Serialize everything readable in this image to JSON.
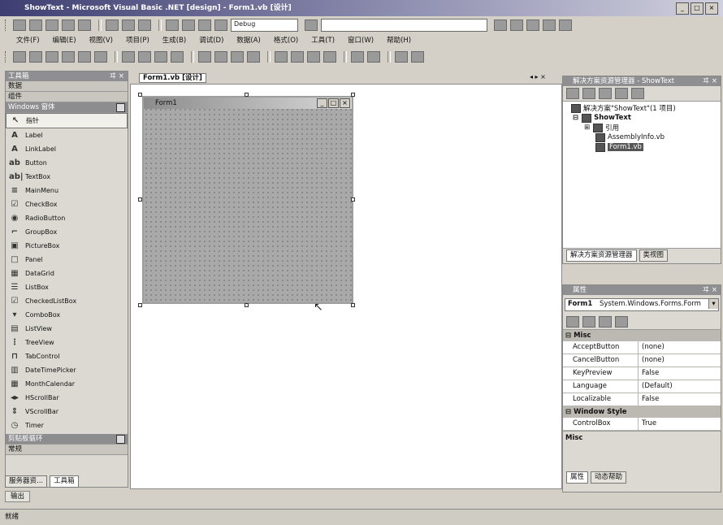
{
  "window": {
    "title": "ShowText - Microsoft Visual Basic .NET [design] - Form1.vb [设计]",
    "buttons": [
      "_",
      "□",
      "×"
    ]
  },
  "toolbar": {
    "config_combo": "Debug",
    "find_combo": ""
  },
  "menubar": {
    "items": [
      "文件(F)",
      "编辑(E)",
      "视图(V)",
      "项目(P)",
      "生成(B)",
      "调试(D)",
      "数据(A)",
      "格式(O)",
      "工具(T)",
      "窗口(W)",
      "帮助(H)"
    ]
  },
  "toolbox": {
    "title": "工具箱",
    "pin": "ヰ ×",
    "categories_top": [
      "数据",
      "组件"
    ],
    "active_category": "Windows 窗体",
    "tools": [
      {
        "label": "指针",
        "icon": "pointer-icon",
        "glyph": "↖"
      },
      {
        "label": "Label",
        "icon": "label-icon",
        "glyph": "A"
      },
      {
        "label": "LinkLabel",
        "icon": "linklabel-icon",
        "glyph": "A"
      },
      {
        "label": "Button",
        "icon": "button-icon",
        "glyph": "ab"
      },
      {
        "label": "TextBox",
        "icon": "textbox-icon",
        "glyph": "ab|"
      },
      {
        "label": "MainMenu",
        "icon": "mainmenu-icon",
        "glyph": "≡"
      },
      {
        "label": "CheckBox",
        "icon": "checkbox-icon",
        "glyph": "☑"
      },
      {
        "label": "RadioButton",
        "icon": "radiobutton-icon",
        "glyph": "◉"
      },
      {
        "label": "GroupBox",
        "icon": "groupbox-icon",
        "glyph": "⌐"
      },
      {
        "label": "PictureBox",
        "icon": "picturebox-icon",
        "glyph": "▣"
      },
      {
        "label": "Panel",
        "icon": "panel-icon",
        "glyph": "□"
      },
      {
        "label": "DataGrid",
        "icon": "datagrid-icon",
        "glyph": "▦"
      },
      {
        "label": "ListBox",
        "icon": "listbox-icon",
        "glyph": "☰"
      },
      {
        "label": "CheckedListBox",
        "icon": "checkedlistbox-icon",
        "glyph": "☑"
      },
      {
        "label": "ComboBox",
        "icon": "combobox-icon",
        "glyph": "▾"
      },
      {
        "label": "ListView",
        "icon": "listview-icon",
        "glyph": "▤"
      },
      {
        "label": "TreeView",
        "icon": "treeview-icon",
        "glyph": "⋮"
      },
      {
        "label": "TabControl",
        "icon": "tabcontrol-icon",
        "glyph": "⊓"
      },
      {
        "label": "DateTimePicker",
        "icon": "datetimepicker-icon",
        "glyph": "▥"
      },
      {
        "label": "MonthCalendar",
        "icon": "monthcalendar-icon",
        "glyph": "▦"
      },
      {
        "label": "HScrollBar",
        "icon": "hscrollbar-icon",
        "glyph": "◂▸"
      },
      {
        "label": "VScrollBar",
        "icon": "vscrollbar-icon",
        "glyph": "⇕"
      },
      {
        "label": "Timer",
        "icon": "timer-icon",
        "glyph": "◷"
      }
    ],
    "categories_bottom": [
      "剪贴板循环",
      "常规"
    ],
    "bottom_tabs": [
      "服务器资...",
      "工具箱"
    ]
  },
  "document": {
    "tab_label": "Form1.vb [设计]",
    "nav": "◂ ▸ ×",
    "form_title": "Form1",
    "form_buttons": [
      "_",
      "□",
      "×"
    ]
  },
  "solution": {
    "title": "解决方案资源管理器 - ShowText",
    "pin": "ヰ ×",
    "nodes": [
      {
        "label": "解决方案\"ShowText\"(1 项目)",
        "indent": 0
      },
      {
        "label": "ShowText",
        "indent": 1
      },
      {
        "label": "引用",
        "indent": 2
      },
      {
        "label": "AssemblyInfo.vb",
        "indent": 2
      },
      {
        "label": "Form1.vb",
        "indent": 2
      }
    ],
    "tabs": [
      "解决方案资源管理器",
      "类视图"
    ]
  },
  "properties": {
    "title": "属性",
    "pin": "ヰ ×",
    "object_name": "Form1",
    "object_type": "System.Windows.Forms.Form",
    "category_misc": "Misc",
    "rows_misc": [
      {
        "name": "AcceptButton",
        "value": "(none)"
      },
      {
        "name": "CancelButton",
        "value": "(none)"
      },
      {
        "name": "KeyPreview",
        "value": "False"
      },
      {
        "name": "Language",
        "value": "(Default)"
      },
      {
        "name": "Localizable",
        "value": "False"
      }
    ],
    "category_window": "Window Style",
    "rows_window": [
      {
        "name": "ControlBox",
        "value": "True"
      }
    ],
    "description": "Misc",
    "bottom_tabs": [
      "属性",
      "动态帮助"
    ]
  },
  "output_tab": "输出",
  "status": "就绪",
  "colors": {
    "title_start": "#3e3e72",
    "panel_bg": "#dcd9d2",
    "form_grid": "#a9a9a9"
  }
}
